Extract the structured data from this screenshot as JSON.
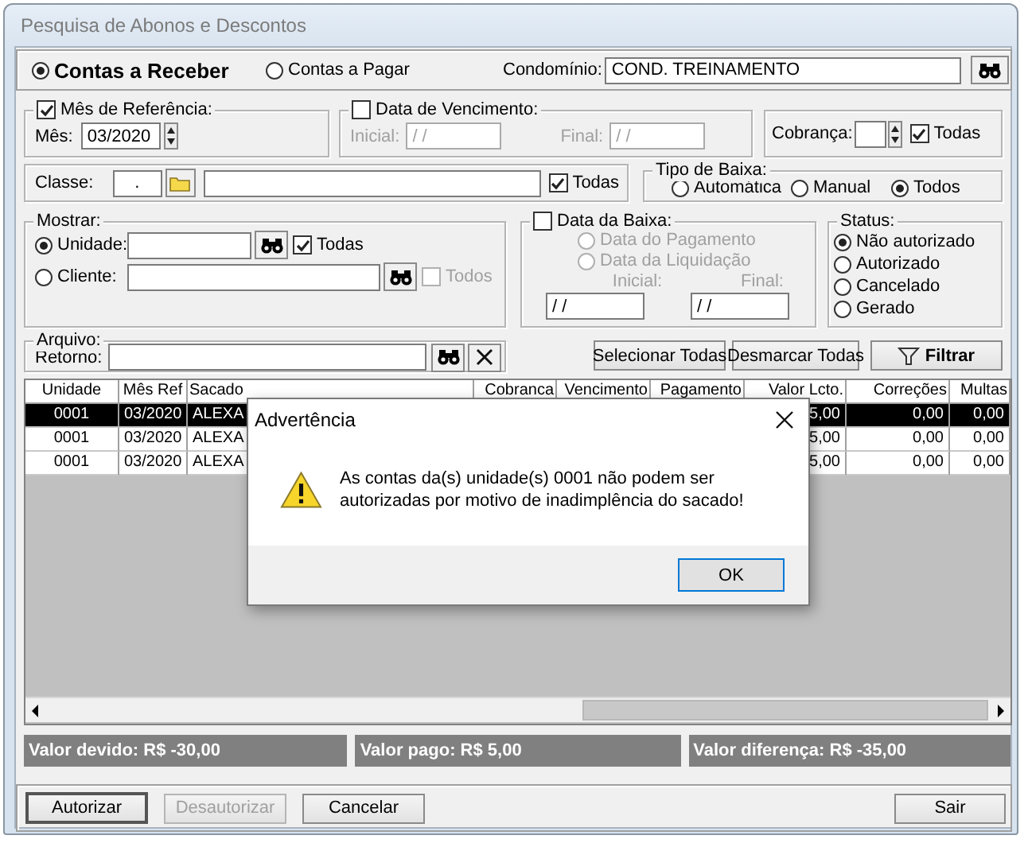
{
  "window": {
    "title": "Pesquisa de Abonos e Descontos"
  },
  "account_type": {
    "options": [
      {
        "label": "Contas a Receber",
        "selected": true
      },
      {
        "label": "Contas a Pagar",
        "selected": false
      }
    ]
  },
  "condominio": {
    "label": "Condomínio:",
    "value": "COND. TREINAMENTO"
  },
  "mes_referencia": {
    "label": "Mês de Referência:",
    "checked": true,
    "field_label": "Mês:",
    "value": "03/2020"
  },
  "data_vencimento": {
    "label": "Data de Vencimento:",
    "checked": false,
    "inicial_label": "Inicial:",
    "inicial": "/ /",
    "final_label": "Final:",
    "final": "/ /"
  },
  "cobranca": {
    "label": "Cobrança:",
    "todas": {
      "label": "Todas",
      "checked": true
    }
  },
  "classe": {
    "label": "Classe:",
    "code": ".",
    "todas": {
      "label": "Todas",
      "checked": true
    }
  },
  "tipo_baixa": {
    "label": "Tipo de Baixa:",
    "options": [
      {
        "label": "Automática",
        "selected": false
      },
      {
        "label": "Manual",
        "selected": false
      },
      {
        "label": "Todos",
        "selected": true
      }
    ]
  },
  "mostrar": {
    "label": "Mostrar:",
    "options": [
      {
        "label": "Unidade:",
        "selected": true,
        "todas": {
          "label": "Todas",
          "checked": true
        }
      },
      {
        "label": "Cliente:",
        "selected": false,
        "todas": {
          "label": "Todos",
          "checked": false
        }
      }
    ]
  },
  "data_baixa": {
    "label": "Data da Baixa:",
    "checked": false,
    "options": [
      {
        "label": "Data do Pagamento",
        "selected": false
      },
      {
        "label": "Data da Liquidação",
        "selected": false
      }
    ],
    "inicial_label": "Inicial:",
    "inicial": "/ /",
    "final_label": "Final:",
    "final": "/ /"
  },
  "status": {
    "label": "Status:",
    "options": [
      {
        "label": "Não autorizado",
        "selected": true
      },
      {
        "label": "Autorizado",
        "selected": false
      },
      {
        "label": "Cancelado",
        "selected": false
      },
      {
        "label": "Gerado",
        "selected": false
      }
    ]
  },
  "arquivo": {
    "label": "Arquivo:",
    "field_label": "Retorno:"
  },
  "actions": [
    {
      "label": "Selecionar Todas",
      "kind": "plain"
    },
    {
      "label": "Desmarcar Todas",
      "kind": "plain"
    },
    {
      "label": "Filtrar",
      "kind": "filter"
    }
  ],
  "table": {
    "columns": [
      {
        "label": "Unidade",
        "kind": "code",
        "cells": [
          "0001",
          "0001",
          "0001"
        ]
      },
      {
        "label": "Mês Ref",
        "kind": "code",
        "cells": [
          "03/2020",
          "03/2020",
          "03/2020"
        ]
      },
      {
        "label": "Sacado",
        "kind": "text",
        "cells": [
          "ALEXA",
          "ALEXA",
          "ALEXA"
        ]
      },
      {
        "label": "Cobranca",
        "kind": "number"
      },
      {
        "label": "Vencimento",
        "kind": "number"
      },
      {
        "label": "Pagamento",
        "kind": "number"
      },
      {
        "label": "Valor Lcto.",
        "kind": "number",
        "cells": [
          "5,00",
          "5,00",
          "5,00"
        ]
      },
      {
        "label": "Correções",
        "kind": "number",
        "cells": [
          "0,00",
          "0,00",
          "0,00"
        ]
      },
      {
        "label": "Multas",
        "kind": "number",
        "cells": [
          "0,00",
          "0,00",
          "0,00"
        ]
      }
    ],
    "rows": [
      {
        "selected": true
      },
      {
        "selected": false
      },
      {
        "selected": false
      }
    ]
  },
  "totals": [
    "Valor devido: R$ -30,00",
    "Valor pago: R$ 5,00",
    "Valor diferença: R$ -35,00"
  ],
  "buttons": [
    {
      "label": "Autorizar",
      "default": true,
      "disabled": false
    },
    {
      "label": "Desautorizar",
      "default": false,
      "disabled": true
    },
    {
      "label": "Cancelar",
      "default": false,
      "disabled": false
    },
    {
      "label": "Sair",
      "default": false,
      "disabled": false
    }
  ],
  "dialog": {
    "title": "Advertência",
    "message": "As contas da(s) unidade(s) 0001 não podem ser autorizadas por motivo de inadimplência do sacado!",
    "button": "OK"
  }
}
